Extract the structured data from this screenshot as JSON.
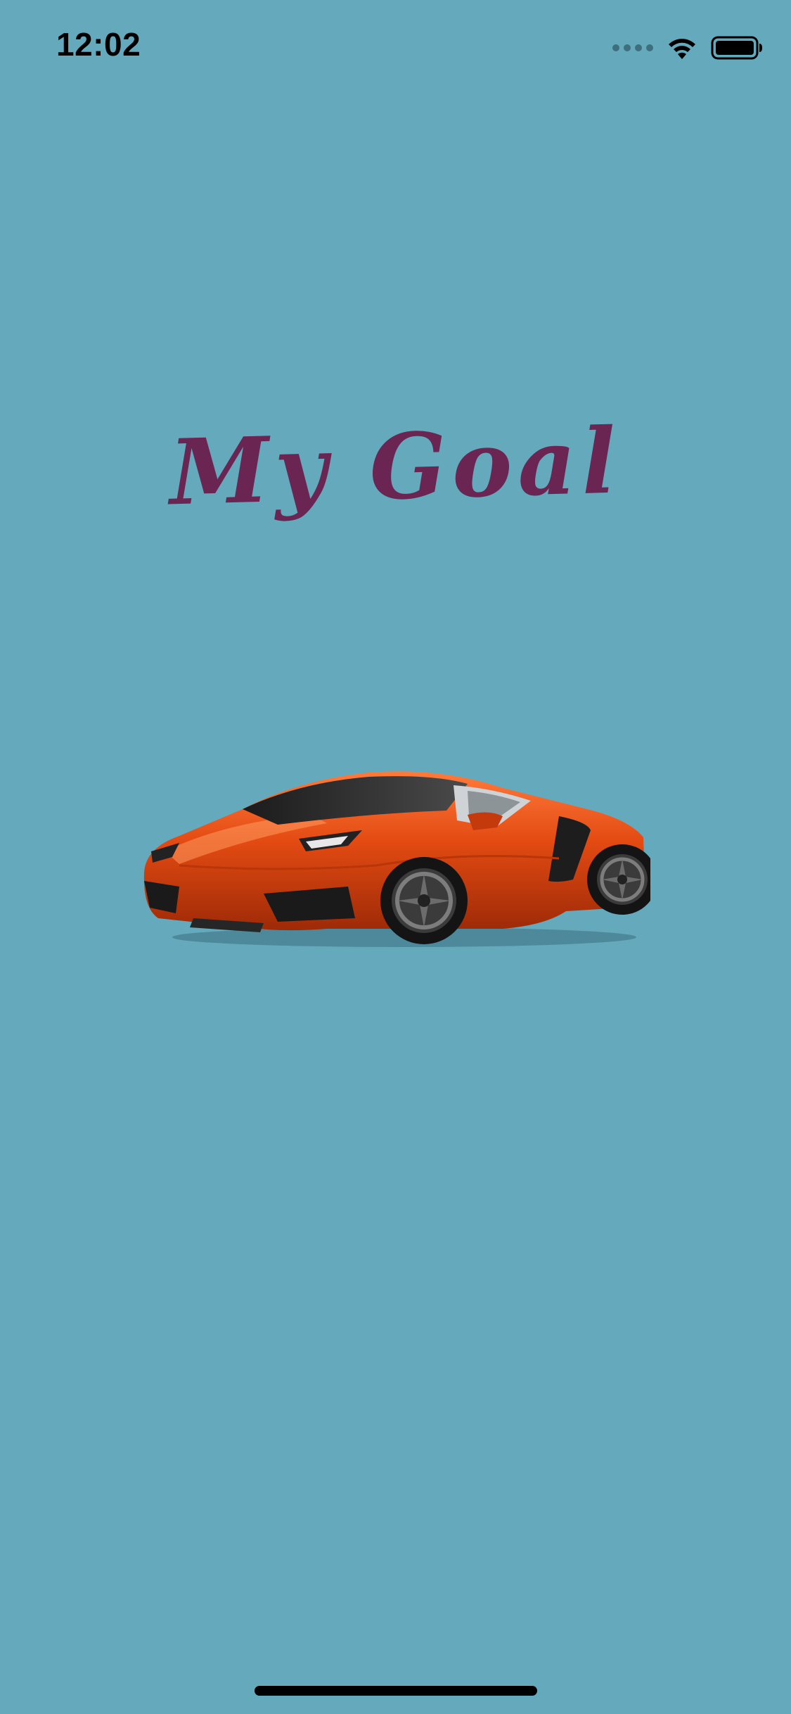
{
  "status_bar": {
    "time": "12:02"
  },
  "main": {
    "title": "My Goal",
    "image": "orange-sports-car"
  },
  "colors": {
    "background": "#64a9bc",
    "title": "#6a2552",
    "car_body": "#e24a12"
  }
}
